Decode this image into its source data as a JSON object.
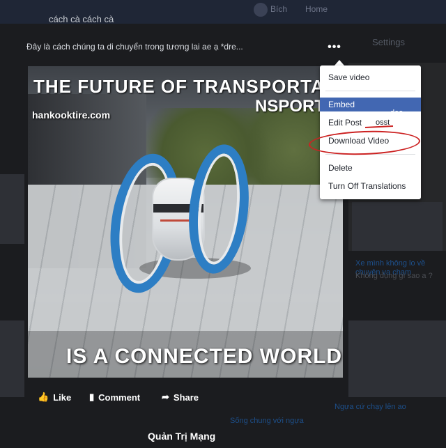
{
  "background": {
    "nav_user": "Bích",
    "nav_home": "Home",
    "settings_label": "Settings",
    "right_snippets": [
      "Xe mình không lo về chuyện va chạm",
      "Không đụng gì sao a ?"
    ],
    "bottom_snippets": [
      "Sống chung với ngựa",
      "Ngựa cứ chạy lên ao"
    ]
  },
  "post": {
    "header": "cách cà cách cà",
    "caption": "Đây là cách chúng ta di chuyển trong tương lai ae ạ *dre...",
    "options_label": "•••"
  },
  "video": {
    "headline_top": "THE FUTURE OF TRANSPORTATIO",
    "headline_top_line2": "NSPORT",
    "watermark": "hankooktire.com",
    "headline_bottom": "IS A CONNECTED WORLD"
  },
  "menu": {
    "items": [
      {
        "label": "Save video",
        "highlighted": false
      },
      {
        "label": "Embed",
        "highlighted": true
      },
      {
        "label": "Edit Post",
        "highlighted": false
      },
      {
        "label": "Download Video",
        "highlighted": false
      },
      {
        "label": "Delete",
        "highlighted": false
      },
      {
        "label": "Turn Off Translations",
        "highlighted": false
      }
    ],
    "ghost_text": [
      "deo",
      "osst"
    ],
    "highlight_color": "#4267b2",
    "annotation_color": "#cc2222"
  },
  "actions": {
    "like": "Like",
    "comment": "Comment",
    "share": "Share"
  },
  "credit": "Quản Trị Mạng"
}
